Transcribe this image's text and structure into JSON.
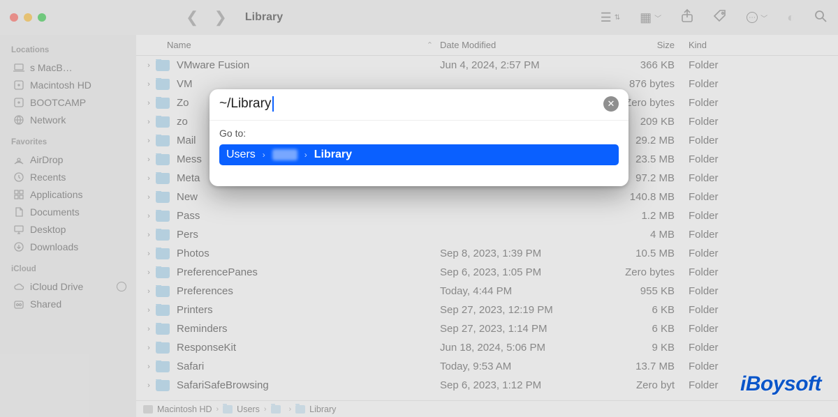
{
  "window_title": "Library",
  "traffic_lights": {
    "close": "#ff5f57",
    "min": "#febc2e",
    "max": "#28c840"
  },
  "sidebar": {
    "sections": [
      {
        "title": "Locations",
        "items": [
          {
            "icon": "laptop",
            "label": "s MacB…"
          },
          {
            "icon": "disk",
            "label": "Macintosh HD"
          },
          {
            "icon": "disk",
            "label": "BOOTCAMP"
          },
          {
            "icon": "globe",
            "label": "Network"
          }
        ]
      },
      {
        "title": "Favorites",
        "items": [
          {
            "icon": "airdrop",
            "label": "AirDrop"
          },
          {
            "icon": "clock",
            "label": "Recents"
          },
          {
            "icon": "apps",
            "label": "Applications"
          },
          {
            "icon": "doc",
            "label": "Documents"
          },
          {
            "icon": "desktop",
            "label": "Desktop"
          },
          {
            "icon": "download",
            "label": "Downloads"
          }
        ]
      },
      {
        "title": "iCloud",
        "items": [
          {
            "icon": "cloud",
            "label": "iCloud Drive",
            "trailing": "progress"
          },
          {
            "icon": "share",
            "label": "Shared"
          }
        ]
      }
    ]
  },
  "columns": {
    "name": "Name",
    "date": "Date Modified",
    "size": "Size",
    "kind": "Kind"
  },
  "rows": [
    {
      "expandable": true,
      "name": "VMware Fusion",
      "date": "Jun 4, 2024, 2:57 PM",
      "size": "366 KB",
      "kind": "Folder"
    },
    {
      "expandable": true,
      "name": "VM",
      "date": "",
      "size": "876 bytes",
      "kind": "Folder"
    },
    {
      "expandable": true,
      "name": "Zo",
      "date": "",
      "size": "Zero bytes",
      "kind": "Folder"
    },
    {
      "expandable": true,
      "name": "zo",
      "date": "",
      "size": "209 KB",
      "kind": "Folder"
    },
    {
      "expandable": true,
      "name": "Mail",
      "date": "",
      "size": "29.2 MB",
      "kind": "Folder"
    },
    {
      "expandable": true,
      "name": "Mess",
      "date": "",
      "size": "23.5 MB",
      "kind": "Folder"
    },
    {
      "expandable": true,
      "name": "Meta",
      "date": "",
      "size": "97.2 MB",
      "kind": "Folder"
    },
    {
      "expandable": true,
      "name": "New",
      "date": "",
      "size": "140.8 MB",
      "kind": "Folder"
    },
    {
      "expandable": true,
      "name": "Pass",
      "date": "",
      "size": "1.2 MB",
      "kind": "Folder"
    },
    {
      "expandable": true,
      "name": "Pers",
      "date": "",
      "size": "4 MB",
      "kind": "Folder"
    },
    {
      "expandable": true,
      "name": "Photos",
      "date": "Sep 8, 2023, 1:39 PM",
      "size": "10.5 MB",
      "kind": "Folder"
    },
    {
      "expandable": true,
      "name": "PreferencePanes",
      "date": "Sep 6, 2023, 1:05 PM",
      "size": "Zero bytes",
      "kind": "Folder"
    },
    {
      "expandable": true,
      "name": "Preferences",
      "date": "Today, 4:44 PM",
      "size": "955 KB",
      "kind": "Folder"
    },
    {
      "expandable": true,
      "name": "Printers",
      "date": "Sep 27, 2023, 12:19 PM",
      "size": "6 KB",
      "kind": "Folder"
    },
    {
      "expandable": true,
      "name": "Reminders",
      "date": "Sep 27, 2023, 1:14 PM",
      "size": "6 KB",
      "kind": "Folder"
    },
    {
      "expandable": true,
      "name": "ResponseKit",
      "date": "Jun 18, 2024, 5:06 PM",
      "size": "9 KB",
      "kind": "Folder"
    },
    {
      "expandable": true,
      "name": "Safari",
      "date": "Today, 9:53 AM",
      "size": "13.7 MB",
      "kind": "Folder"
    },
    {
      "expandable": true,
      "name": "SafariSafeBrowsing",
      "date": "Sep 6, 2023, 1:12 PM",
      "size": "Zero byt",
      "kind": "Folder"
    }
  ],
  "pathbar": [
    {
      "icon": "disk",
      "label": "Macintosh HD"
    },
    {
      "icon": "folder",
      "label": "Users"
    },
    {
      "icon": "folder",
      "label": ""
    },
    {
      "icon": "folder",
      "label": "Library"
    }
  ],
  "dialog": {
    "input_value": "~/Library",
    "go_to_label": "Go to:",
    "path_segments": [
      {
        "text": "Users",
        "bold": false
      },
      {
        "text": "",
        "bold": false,
        "blurred": true
      },
      {
        "text": "Library",
        "bold": true
      }
    ]
  },
  "watermark": "iBoysoft"
}
